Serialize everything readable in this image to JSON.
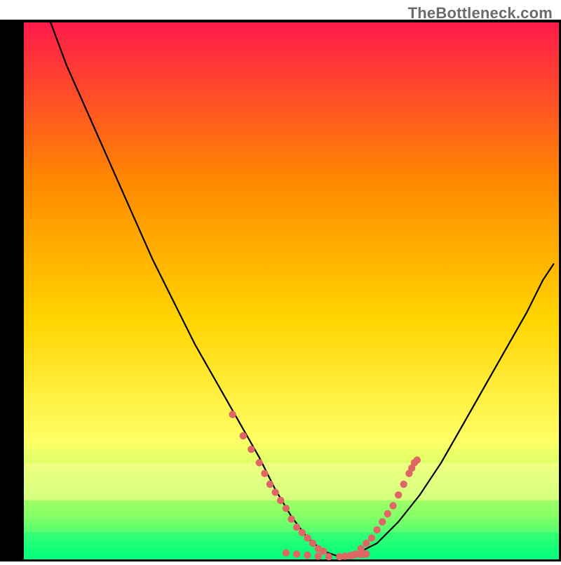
{
  "watermark_text": "TheBottleneck.com",
  "chart_data": {
    "type": "line",
    "title": "",
    "xlabel": "",
    "ylabel": "",
    "xlim": [
      0,
      100
    ],
    "ylim": [
      0,
      100
    ],
    "background_gradient": {
      "top": "#ff1a4a",
      "mid_top": "#ff8a00",
      "mid": "#ffd400",
      "mid_low": "#ffff66",
      "low": "#85ff66",
      "bottom": "#00ff80"
    },
    "band": {
      "yellow_y": [
        18,
        11
      ],
      "green_y": [
        5,
        0
      ]
    },
    "series": [
      {
        "name": "bottleneck-curve",
        "type": "line",
        "color": "#000000",
        "x": [
          5,
          8,
          12,
          16,
          20,
          24,
          28,
          32,
          36,
          40,
          44,
          47,
          50,
          53,
          56,
          59,
          62,
          66,
          70,
          74,
          78,
          82,
          86,
          90,
          94,
          97,
          99
        ],
        "y": [
          100,
          92,
          83,
          74,
          65,
          56,
          48,
          40,
          33,
          26,
          19,
          13,
          8,
          4,
          1.5,
          0.5,
          1,
          3,
          7,
          12,
          18,
          25,
          32,
          39,
          46,
          52,
          55
        ]
      },
      {
        "name": "left-branch-markers",
        "type": "scatter",
        "color": "#e06666",
        "x": [
          39,
          41,
          42.5,
          44,
          45,
          46,
          47,
          48,
          49,
          50,
          51,
          52,
          53,
          54,
          55,
          56
        ],
        "y": [
          27,
          23,
          20.5,
          18,
          16,
          14,
          12.5,
          11,
          9.5,
          7.5,
          6,
          5,
          4,
          3,
          2,
          1.5
        ]
      },
      {
        "name": "right-branch-markers",
        "type": "scatter",
        "color": "#e06666",
        "x": [
          62,
          63,
          64,
          65,
          66,
          67,
          68,
          69,
          70,
          71,
          72,
          72.5,
          73,
          73.5
        ],
        "y": [
          1,
          2,
          3,
          4,
          5.5,
          7,
          8.5,
          10,
          12,
          14,
          16,
          17,
          18,
          18.5
        ]
      },
      {
        "name": "bottom-markers",
        "type": "scatter",
        "color": "#e06666",
        "x": [
          49,
          51,
          53,
          55,
          57,
          59,
          60,
          61,
          61.5,
          62,
          63,
          63.5,
          64
        ],
        "y": [
          1.2,
          1.0,
          0.8,
          0.6,
          0.5,
          0.5,
          0.6,
          0.7,
          0.8,
          0.9,
          0.9,
          1.0,
          1.0
        ]
      }
    ]
  }
}
